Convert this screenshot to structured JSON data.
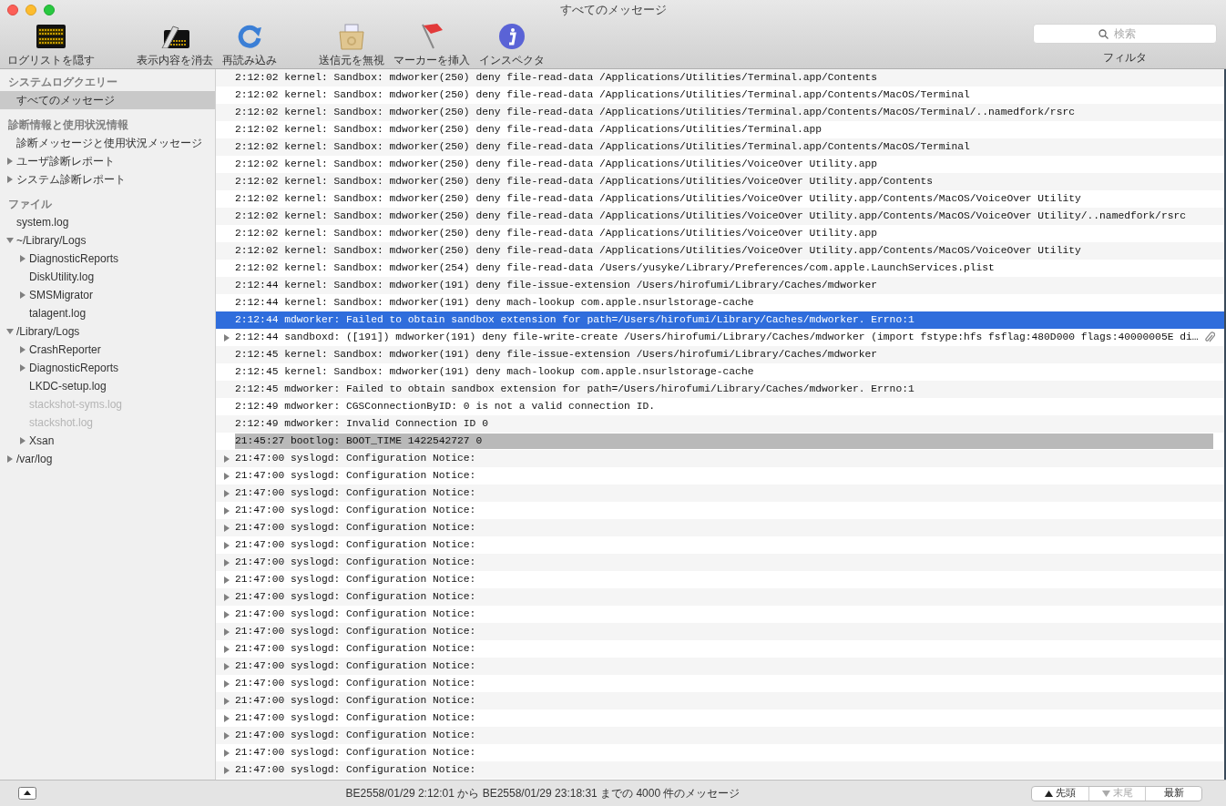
{
  "window": {
    "title": "すべてのメッセージ"
  },
  "toolbar": {
    "groups": [
      {
        "items": [
          {
            "label": "ログリストを隠す"
          }
        ]
      },
      {
        "items": [
          {
            "label": "表示内容を消去"
          },
          {
            "label": "再読み込み"
          }
        ]
      },
      {
        "items": [
          {
            "label": "送信元を無視"
          },
          {
            "label": "マーカーを挿入"
          },
          {
            "label": "インスペクタ"
          }
        ]
      }
    ],
    "search": {
      "placeholder": "検索",
      "label": "フィルタ"
    }
  },
  "sidebar": {
    "sections": [
      {
        "title": "システムログクエリー",
        "items": [
          {
            "label": "すべてのメッセージ",
            "selected": true,
            "disabled": false
          }
        ]
      },
      {
        "title": "診断情報と使用状況情報",
        "items": [
          {
            "label": "診断メッセージと使用状況メッセージ",
            "selected": false,
            "disabled": false
          },
          {
            "label": "ユーザ診断レポート",
            "selected": false,
            "disabled": false,
            "expanded": false
          },
          {
            "label": "システム診断レポート",
            "selected": false,
            "disabled": false,
            "expanded": false
          }
        ]
      },
      {
        "title": "ファイル",
        "items": [
          {
            "label": "system.log",
            "selected": false,
            "disabled": false
          },
          {
            "label": "~/Library/Logs",
            "selected": false,
            "disabled": false,
            "expanded": true,
            "children": [
              {
                "label": "DiagnosticReports",
                "selected": false,
                "disabled": false,
                "expanded": false
              },
              {
                "label": "DiskUtility.log",
                "selected": false,
                "disabled": false
              },
              {
                "label": "SMSMigrator",
                "selected": false,
                "disabled": false,
                "expanded": false
              },
              {
                "label": "talagent.log",
                "selected": false,
                "disabled": false
              }
            ]
          },
          {
            "label": "/Library/Logs",
            "selected": false,
            "disabled": false,
            "expanded": true,
            "children": [
              {
                "label": "CrashReporter",
                "selected": false,
                "disabled": false,
                "expanded": false
              },
              {
                "label": "DiagnosticReports",
                "selected": false,
                "disabled": false,
                "expanded": false
              },
              {
                "label": "LKDC-setup.log",
                "selected": false,
                "disabled": false
              },
              {
                "label": "stackshot-syms.log",
                "selected": false,
                "disabled": true
              },
              {
                "label": "stackshot.log",
                "selected": false,
                "disabled": true
              },
              {
                "label": "Xsan",
                "selected": false,
                "disabled": false,
                "expanded": false
              }
            ]
          },
          {
            "label": "/var/log",
            "selected": false,
            "disabled": false,
            "expanded": false
          }
        ]
      }
    ]
  },
  "log": {
    "rows": [
      {
        "text": "2:12:02 kernel: Sandbox: mdworker(250) deny file-read-data /Applications/Utilities/Terminal.app/Contents",
        "kind": "plain",
        "selected": false,
        "expandable": false,
        "attachment": false
      },
      {
        "text": "2:12:02 kernel: Sandbox: mdworker(250) deny file-read-data /Applications/Utilities/Terminal.app/Contents/MacOS/Terminal",
        "kind": "plain",
        "selected": false,
        "expandable": false,
        "attachment": false
      },
      {
        "text": "2:12:02 kernel: Sandbox: mdworker(250) deny file-read-data /Applications/Utilities/Terminal.app/Contents/MacOS/Terminal/..namedfork/rsrc",
        "kind": "plain",
        "selected": false,
        "expandable": false,
        "attachment": false
      },
      {
        "text": "2:12:02 kernel: Sandbox: mdworker(250) deny file-read-data /Applications/Utilities/Terminal.app",
        "kind": "plain",
        "selected": false,
        "expandable": false,
        "attachment": false
      },
      {
        "text": "2:12:02 kernel: Sandbox: mdworker(250) deny file-read-data /Applications/Utilities/Terminal.app/Contents/MacOS/Terminal",
        "kind": "plain",
        "selected": false,
        "expandable": false,
        "attachment": false
      },
      {
        "text": "2:12:02 kernel: Sandbox: mdworker(250) deny file-read-data /Applications/Utilities/VoiceOver Utility.app",
        "kind": "plain",
        "selected": false,
        "expandable": false,
        "attachment": false
      },
      {
        "text": "2:12:02 kernel: Sandbox: mdworker(250) deny file-read-data /Applications/Utilities/VoiceOver Utility.app/Contents",
        "kind": "plain",
        "selected": false,
        "expandable": false,
        "attachment": false
      },
      {
        "text": "2:12:02 kernel: Sandbox: mdworker(250) deny file-read-data /Applications/Utilities/VoiceOver Utility.app/Contents/MacOS/VoiceOver Utility",
        "kind": "plain",
        "selected": false,
        "expandable": false,
        "attachment": false
      },
      {
        "text": "2:12:02 kernel: Sandbox: mdworker(250) deny file-read-data /Applications/Utilities/VoiceOver Utility.app/Contents/MacOS/VoiceOver Utility/..namedfork/rsrc",
        "kind": "plain",
        "selected": false,
        "expandable": false,
        "attachment": false
      },
      {
        "text": "2:12:02 kernel: Sandbox: mdworker(250) deny file-read-data /Applications/Utilities/VoiceOver Utility.app",
        "kind": "plain",
        "selected": false,
        "expandable": false,
        "attachment": false
      },
      {
        "text": "2:12:02 kernel: Sandbox: mdworker(250) deny file-read-data /Applications/Utilities/VoiceOver Utility.app/Contents/MacOS/VoiceOver Utility",
        "kind": "plain",
        "selected": false,
        "expandable": false,
        "attachment": false
      },
      {
        "text": "2:12:02 kernel: Sandbox: mdworker(254) deny file-read-data /Users/yusyke/Library/Preferences/com.apple.LaunchServices.plist",
        "kind": "plain",
        "selected": false,
        "expandable": false,
        "attachment": false
      },
      {
        "text": "2:12:44 kernel: Sandbox: mdworker(191) deny file-issue-extension /Users/hirofumi/Library/Caches/mdworker",
        "kind": "plain",
        "selected": false,
        "expandable": false,
        "attachment": false
      },
      {
        "text": "2:12:44 kernel: Sandbox: mdworker(191) deny mach-lookup com.apple.nsurlstorage-cache",
        "kind": "plain",
        "selected": false,
        "expandable": false,
        "attachment": false
      },
      {
        "text": "2:12:44 mdworker: Failed to obtain sandbox extension for path=/Users/hirofumi/Library/Caches/mdworker. Errno:1",
        "kind": "plain",
        "selected": true,
        "expandable": false,
        "attachment": false
      },
      {
        "text": "2:12:44 sandboxd: ([191]) mdworker(191) deny file-write-create /Users/hirofumi/Library/Caches/mdworker (import fstype:hfs fsflag:480D000 flags:40000005E di…",
        "kind": "plain",
        "selected": false,
        "expandable": true,
        "attachment": true
      },
      {
        "text": "2:12:45 kernel: Sandbox: mdworker(191) deny file-issue-extension /Users/hirofumi/Library/Caches/mdworker",
        "kind": "plain",
        "selected": false,
        "expandable": false,
        "attachment": false
      },
      {
        "text": "2:12:45 kernel: Sandbox: mdworker(191) deny mach-lookup com.apple.nsurlstorage-cache",
        "kind": "plain",
        "selected": false,
        "expandable": false,
        "attachment": false
      },
      {
        "text": "2:12:45 mdworker: Failed to obtain sandbox extension for path=/Users/hirofumi/Library/Caches/mdworker. Errno:1",
        "kind": "plain",
        "selected": false,
        "expandable": false,
        "attachment": false
      },
      {
        "text": "2:12:49 mdworker: CGSConnectionByID: 0 is not a valid connection ID.",
        "kind": "plain",
        "selected": false,
        "expandable": false,
        "attachment": false
      },
      {
        "text": "2:12:49 mdworker: Invalid Connection ID 0",
        "kind": "plain",
        "selected": false,
        "expandable": false,
        "attachment": false
      },
      {
        "text": "21:45:27 bootlog: BOOT_TIME 1422542727 0",
        "kind": "marker",
        "selected": false,
        "expandable": false,
        "attachment": false
      },
      {
        "text": "21:47:00 syslogd: Configuration Notice:",
        "kind": "plain",
        "selected": false,
        "expandable": true,
        "attachment": false
      },
      {
        "text": "21:47:00 syslogd: Configuration Notice:",
        "kind": "plain",
        "selected": false,
        "expandable": true,
        "attachment": false
      },
      {
        "text": "21:47:00 syslogd: Configuration Notice:",
        "kind": "plain",
        "selected": false,
        "expandable": true,
        "attachment": false
      },
      {
        "text": "21:47:00 syslogd: Configuration Notice:",
        "kind": "plain",
        "selected": false,
        "expandable": true,
        "attachment": false
      },
      {
        "text": "21:47:00 syslogd: Configuration Notice:",
        "kind": "plain",
        "selected": false,
        "expandable": true,
        "attachment": false
      },
      {
        "text": "21:47:00 syslogd: Configuration Notice:",
        "kind": "plain",
        "selected": false,
        "expandable": true,
        "attachment": false
      },
      {
        "text": "21:47:00 syslogd: Configuration Notice:",
        "kind": "plain",
        "selected": false,
        "expandable": true,
        "attachment": false
      },
      {
        "text": "21:47:00 syslogd: Configuration Notice:",
        "kind": "plain",
        "selected": false,
        "expandable": true,
        "attachment": false
      },
      {
        "text": "21:47:00 syslogd: Configuration Notice:",
        "kind": "plain",
        "selected": false,
        "expandable": true,
        "attachment": false
      },
      {
        "text": "21:47:00 syslogd: Configuration Notice:",
        "kind": "plain",
        "selected": false,
        "expandable": true,
        "attachment": false
      },
      {
        "text": "21:47:00 syslogd: Configuration Notice:",
        "kind": "plain",
        "selected": false,
        "expandable": true,
        "attachment": false
      },
      {
        "text": "21:47:00 syslogd: Configuration Notice:",
        "kind": "plain",
        "selected": false,
        "expandable": true,
        "attachment": false
      },
      {
        "text": "21:47:00 syslogd: Configuration Notice:",
        "kind": "plain",
        "selected": false,
        "expandable": true,
        "attachment": false
      },
      {
        "text": "21:47:00 syslogd: Configuration Notice:",
        "kind": "plain",
        "selected": false,
        "expandable": true,
        "attachment": false
      },
      {
        "text": "21:47:00 syslogd: Configuration Notice:",
        "kind": "plain",
        "selected": false,
        "expandable": true,
        "attachment": false
      },
      {
        "text": "21:47:00 syslogd: Configuration Notice:",
        "kind": "plain",
        "selected": false,
        "expandable": true,
        "attachment": false
      },
      {
        "text": "21:47:00 syslogd: Configuration Notice:",
        "kind": "plain",
        "selected": false,
        "expandable": true,
        "attachment": false
      },
      {
        "text": "21:47:00 syslogd: Configuration Notice:",
        "kind": "plain",
        "selected": false,
        "expandable": true,
        "attachment": false
      },
      {
        "text": "21:47:00 syslogd: Configuration Notice:",
        "kind": "plain",
        "selected": false,
        "expandable": true,
        "attachment": false
      }
    ]
  },
  "status_bar": {
    "text": "BE2558/01/29 2:12:01 から BE2558/01/29 23:18:31 までの 4000 件のメッセージ",
    "buttons": [
      {
        "label": "先頭",
        "kind": "up",
        "disabled": false
      },
      {
        "label": "末尾",
        "kind": "down",
        "disabled": true
      },
      {
        "label": "最新",
        "kind": "plain",
        "disabled": false
      }
    ]
  }
}
